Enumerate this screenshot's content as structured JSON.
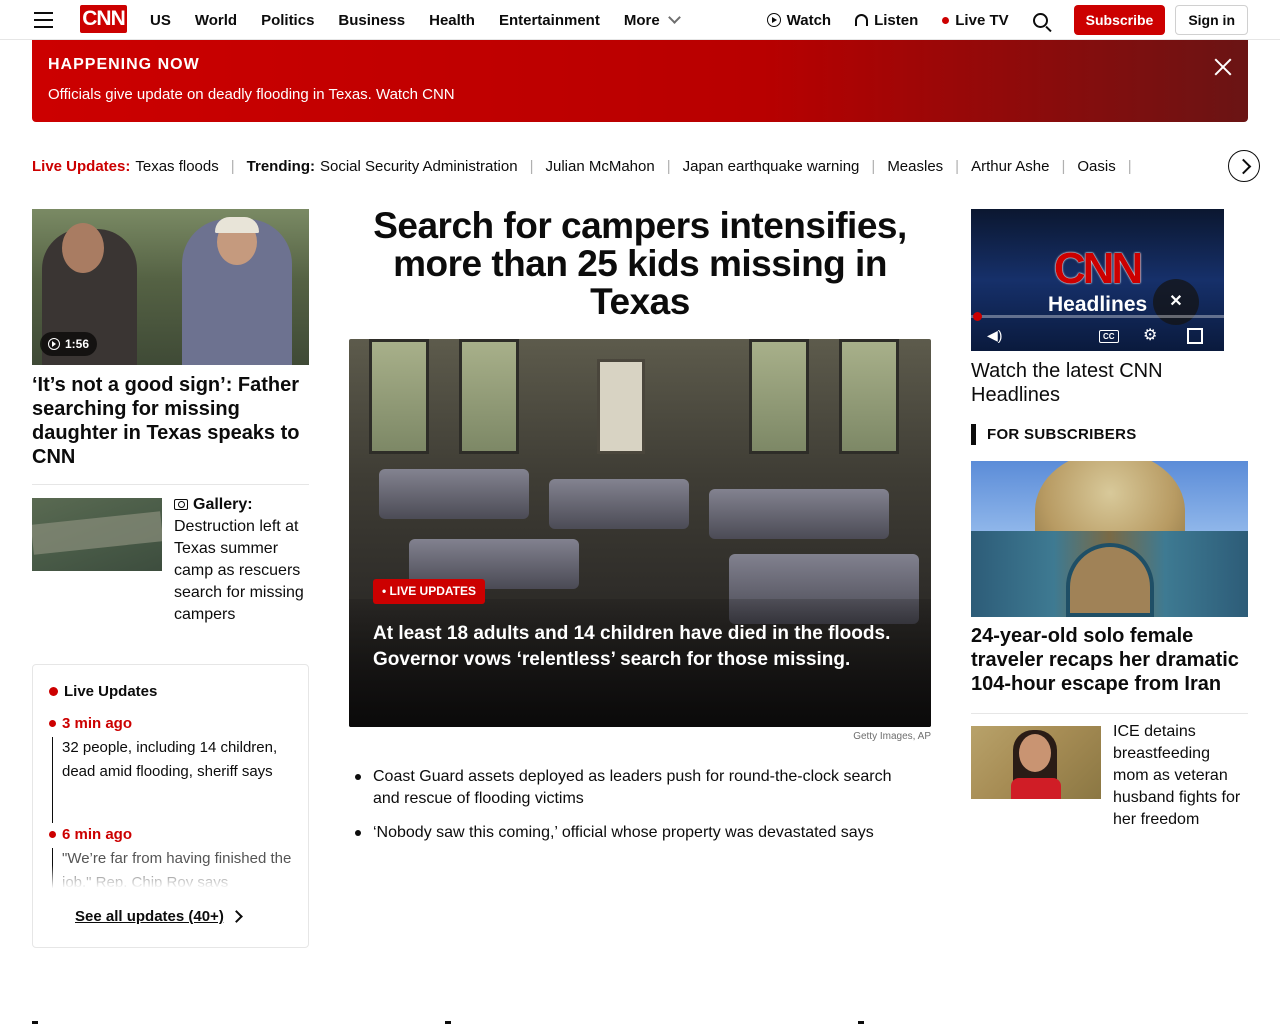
{
  "header": {
    "logo": "CNN",
    "nav": [
      "US",
      "World",
      "Politics",
      "Business",
      "Health",
      "Entertainment"
    ],
    "more_label": "More",
    "watch_label": "Watch",
    "listen_label": "Listen",
    "livetv_label": "Live TV",
    "subscribe_label": "Subscribe",
    "signin_label": "Sign in"
  },
  "banner": {
    "kicker": "HAPPENING NOW",
    "message": "Officials give update on deadly flooding in Texas. Watch CNN"
  },
  "trending": {
    "live_label": "Live Updates:",
    "live_item": "Texas floods",
    "trending_label": "Trending:",
    "items": [
      "Social Security Administration",
      "Julian McMahon",
      "Japan earthquake warning",
      "Measles",
      "Arthur Ashe",
      "Oasis"
    ]
  },
  "left": {
    "video_duration": "1:56",
    "headline": "‘It’s not a good sign’: Father searching for missing daughter in Texas speaks to CNN",
    "gallery_label": "Gallery:",
    "gallery_text": "Destruction left at Texas summer camp as rescuers search for missing campers",
    "live_updates": {
      "title": "Live Updates",
      "entries": [
        {
          "time": "3 min ago",
          "text": "32 people, including 14 children, dead amid flooding, sheriff says"
        },
        {
          "time": "6 min ago",
          "text": "\"We’re far from having finished the job,\" Rep. Chip Roy says"
        }
      ],
      "see_all": "See all updates (40+)"
    }
  },
  "center": {
    "headline": "Search for campers intensifies, more than 25 kids missing in Texas",
    "badge": "• LIVE UPDATES",
    "caption": "At least 18 adults and 14 children have died in the floods. Governor vows ‘relentless’ search for those missing.",
    "credit": "Getty Images, AP",
    "bullets": [
      "Coast Guard assets deployed as leaders push for round-the-clock search and rescue of flooding victims",
      "‘Nobody saw this coming,’ official whose property was devastated says"
    ]
  },
  "right": {
    "video_logo": "CNN",
    "video_sub": "Headlines",
    "video_headline": "Watch the latest CNN Headlines",
    "cc_label": "CC",
    "section_label": "FOR SUBSCRIBERS",
    "sub_headline": "24-year-old solo female traveler recaps her dramatic 104-hour escape from Iran",
    "ice_text": "ICE detains breastfeeding mom as veteran husband fights for her freedom"
  },
  "colors": {
    "brand": "#cc0000",
    "text": "#0c0c0c"
  }
}
